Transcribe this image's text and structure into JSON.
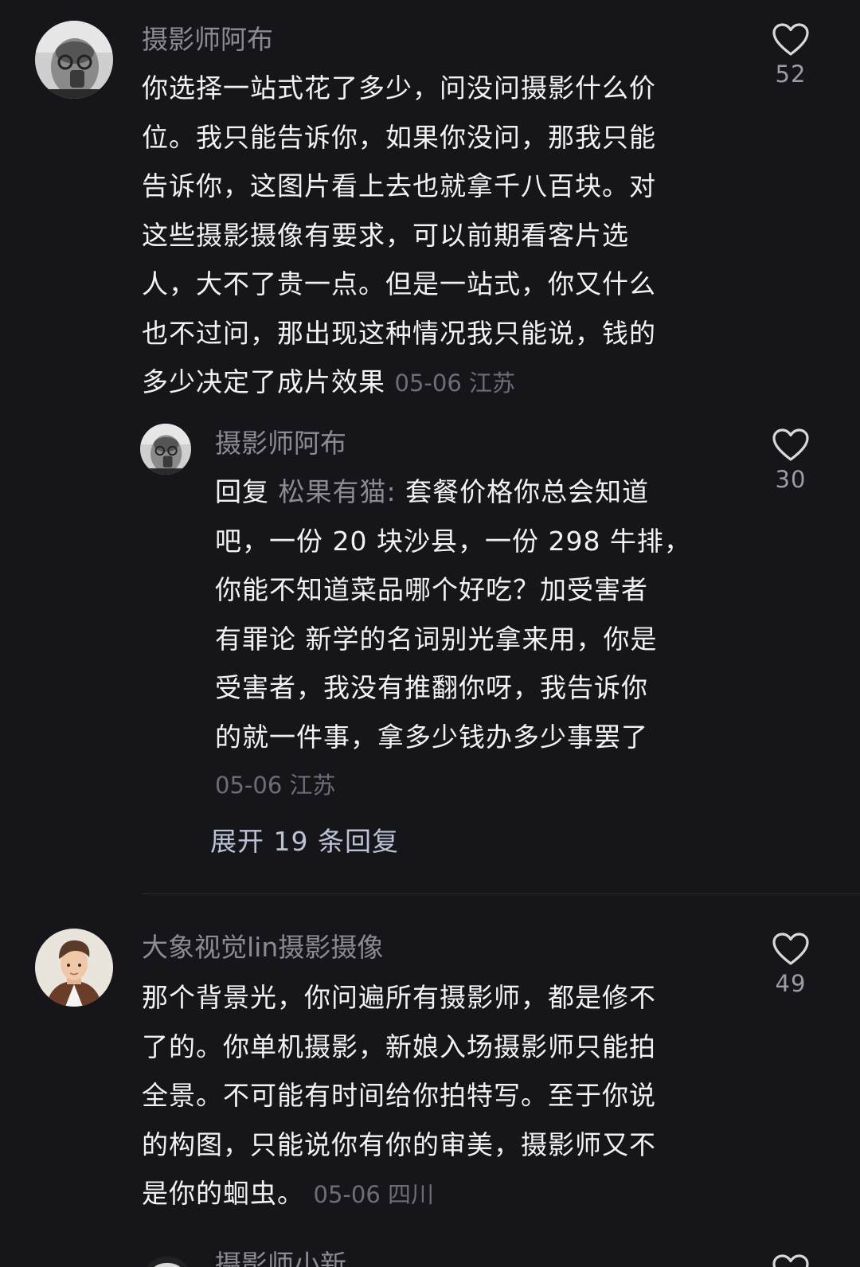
{
  "comments": [
    {
      "username": "摄影师阿布",
      "lines": [
        "你选择一站式花了多少，问没问摄影什么价",
        "位。我只能告诉你，如果你没问，那我只能",
        "告诉你，这图片看上去也就拿千八百块。对",
        "这些摄影摄像有要求，可以前期看客片选",
        "人，大不了贵一点。但是一站式，你又什么",
        "也不过问，那出现这种情况我只能说，钱的",
        "多少决定了成片效果"
      ],
      "meta": "05-06 江苏",
      "likes": "52",
      "reply": {
        "username": "摄影师阿布",
        "prefix": "回复",
        "target": "松果有猫:",
        "lines": [
          "套餐价格你总会知道",
          "吧，一份 20 块沙县，一份 298 牛排，",
          "你能不知道菜品哪个好吃？加受害者",
          "有罪论  新学的名词别光拿来用，你是",
          "受害者，我没有推翻你呀，我告诉你",
          "的就一件事，拿多少钱办多少事罢了"
        ],
        "meta": "05-06 江苏",
        "likes": "30"
      },
      "expand_label": "展开 19 条回复"
    },
    {
      "username": "大象视觉lin摄影摄像",
      "lines": [
        "那个背景光，你问遍所有摄影师，都是修不",
        "了的。你单机摄影，新娘入场摄影师只能拍",
        "全景。不可能有时间给你拍特写。至于你说",
        "的构图，只能说你有你的审美，摄影师又不",
        "是你的蛔虫。"
      ],
      "meta": "05-06 四川",
      "likes": "49"
    },
    {
      "username": "摄影师小新"
    }
  ],
  "icons": {
    "like": "heart-outline-icon"
  },
  "colors": {
    "background": "#16161a",
    "text": "#f2f2f4",
    "username": "#8b8b92",
    "meta": "#6d6d74",
    "expand": "#bcc3d6"
  }
}
